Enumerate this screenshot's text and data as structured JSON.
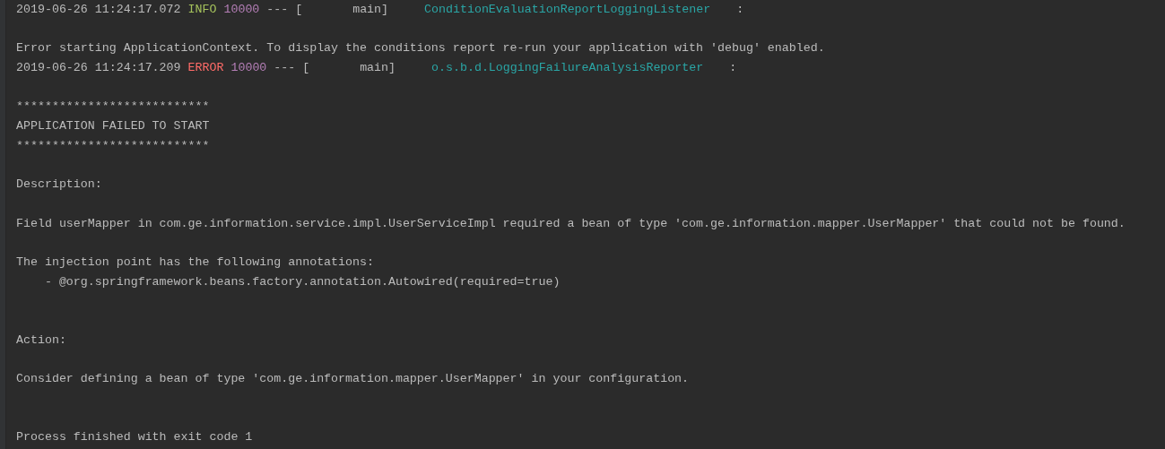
{
  "console": {
    "lines": [
      {
        "kind": "log",
        "timestamp": "2019-06-26 11:24:17.072",
        "level": "INFO",
        "color": "#a5c25c",
        "pid": "10000",
        "separator": "---",
        "thread": "[       main]",
        "logger": "ConditionEvaluationReportLoggingListener",
        "tail": ":"
      },
      {
        "kind": "blank"
      },
      {
        "kind": "text",
        "text": "Error starting ApplicationContext. To display the conditions report re-run your application with 'debug' enabled."
      },
      {
        "kind": "log",
        "timestamp": "2019-06-26 11:24:17.209",
        "level": "ERROR",
        "color": "#ff6b68",
        "pid": "10000",
        "separator": "---",
        "thread": "[       main]",
        "logger": "o.s.b.d.LoggingFailureAnalysisReporter",
        "tail": ":"
      },
      {
        "kind": "blank"
      },
      {
        "kind": "text",
        "text": "***************************"
      },
      {
        "kind": "text",
        "text": "APPLICATION FAILED TO START"
      },
      {
        "kind": "text",
        "text": "***************************"
      },
      {
        "kind": "blank"
      },
      {
        "kind": "text",
        "text": "Description:"
      },
      {
        "kind": "blank"
      },
      {
        "kind": "text",
        "text": "Field userMapper in com.ge.information.service.impl.UserServiceImpl required a bean of type 'com.ge.information.mapper.UserMapper' that could not be found."
      },
      {
        "kind": "blank"
      },
      {
        "kind": "text",
        "text": "The injection point has the following annotations:"
      },
      {
        "kind": "text",
        "text": "    - @org.springframework.beans.factory.annotation.Autowired(required=true)"
      },
      {
        "kind": "blank"
      },
      {
        "kind": "blank"
      },
      {
        "kind": "text",
        "text": "Action:"
      },
      {
        "kind": "blank"
      },
      {
        "kind": "text",
        "text": "Consider defining a bean of type 'com.ge.information.mapper.UserMapper' in your configuration."
      },
      {
        "kind": "blank"
      },
      {
        "kind": "blank"
      },
      {
        "kind": "text",
        "text": "Process finished with exit code 1"
      }
    ]
  }
}
